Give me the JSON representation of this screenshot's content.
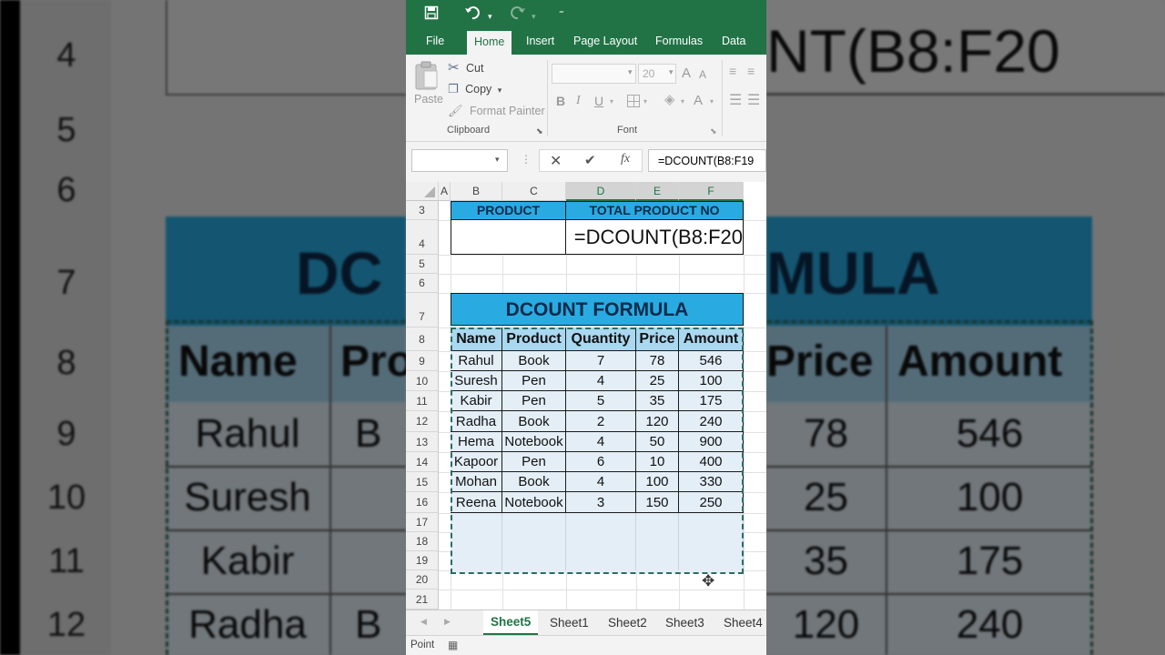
{
  "qat": {
    "save_icon": "save-icon",
    "undo_icon": "undo-icon",
    "redo_icon": "redo-icon",
    "customize_icon": "customize-qat-icon"
  },
  "ribbon_tabs": [
    "File",
    "Home",
    "Insert",
    "Page Layout",
    "Formulas",
    "Data"
  ],
  "active_tab": "Home",
  "clipboard": {
    "paste": "Paste",
    "cut": "Cut",
    "copy": "Copy",
    "format_painter": "Format Painter",
    "group_label": "Clipboard"
  },
  "font": {
    "size": "20",
    "bold": "B",
    "italic": "I",
    "underline": "U",
    "grow": "A",
    "shrink": "A",
    "font_color": "A",
    "group_label": "Font"
  },
  "formula_bar": {
    "name_box": "",
    "cancel": "✕",
    "enter": "✔",
    "fx": "fx",
    "formula": "=DCOUNT(B8:F19"
  },
  "columns": [
    "A",
    "B",
    "C",
    "D",
    "E",
    "F"
  ],
  "rows": [
    "3",
    "4",
    "5",
    "6",
    "7",
    "8",
    "9",
    "10",
    "11",
    "12",
    "13",
    "14",
    "15",
    "16",
    "17",
    "18",
    "19",
    "20",
    "21"
  ],
  "sheet": {
    "header_product": "PRODUCT",
    "header_total": "TOTAL PRODUCT NO",
    "editing_formula": "=DCOUNT(B8:F20",
    "table_title": "DCOUNT FORMULA",
    "table_headers": [
      "Name",
      "Product",
      "Quantity",
      "Price",
      "Amount"
    ],
    "table_rows": [
      [
        "Rahul",
        "Book",
        "7",
        "78",
        "546"
      ],
      [
        "Suresh",
        "Pen",
        "4",
        "25",
        "100"
      ],
      [
        "Kabir",
        "Pen",
        "5",
        "35",
        "175"
      ],
      [
        "Radha",
        "Book",
        "2",
        "120",
        "240"
      ],
      [
        "Hema",
        "Notebook",
        "4",
        "50",
        "900"
      ],
      [
        "Kapoor",
        "Pen",
        "6",
        "10",
        "400"
      ],
      [
        "Mohan",
        "Book",
        "4",
        "100",
        "330"
      ],
      [
        "Reena",
        "Notebook",
        "3",
        "150",
        "250"
      ]
    ]
  },
  "sheet_tabs": [
    "Sheet5",
    "Sheet1",
    "Sheet2",
    "Sheet3",
    "Sheet4"
  ],
  "active_sheet": "Sheet5",
  "status": {
    "mode": "Point"
  },
  "background_zoom": {
    "rows": [
      "4",
      "5",
      "6",
      "7",
      "8",
      "9",
      "10",
      "11",
      "12"
    ],
    "formula": "NT(B8:F20",
    "title_left": "DC",
    "title_right": "MULA",
    "headers_left": [
      "Name",
      "Pro"
    ],
    "headers_right": [
      "Price",
      "Amount"
    ],
    "names": [
      "Rahul",
      "Suresh",
      "Kabir",
      "Radha"
    ],
    "products_left": [
      "B",
      "",
      "",
      "B"
    ],
    "prices": [
      "78",
      "25",
      "35",
      "120"
    ],
    "amounts": [
      "546",
      "100",
      "175",
      "240"
    ]
  },
  "colors": {
    "excel_green": "#217346",
    "header_blue": "#29abe2",
    "table_header_blue": "#a9d8f0",
    "selection_tint": "#e3eef7"
  }
}
